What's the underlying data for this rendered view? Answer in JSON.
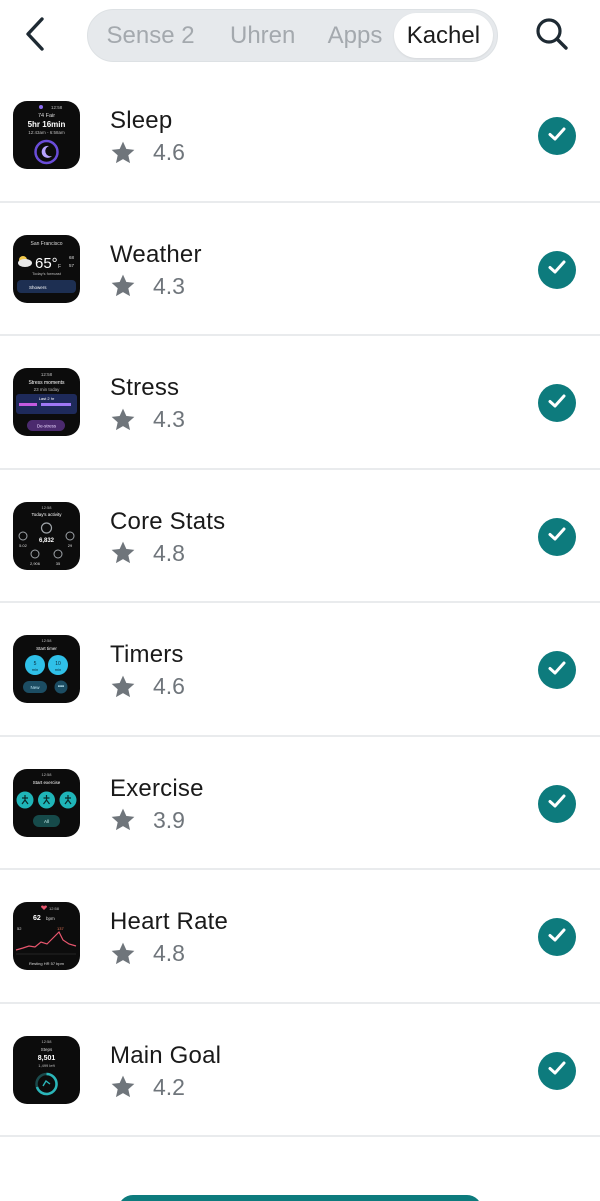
{
  "header": {
    "tabs": [
      {
        "label": "Sense 2",
        "active": false
      },
      {
        "label": "Uhren",
        "active": false
      },
      {
        "label": "Apps",
        "active": false
      },
      {
        "label": "Kachel",
        "active": true
      }
    ],
    "back_icon": "chevron-left-icon",
    "search_icon": "search-icon"
  },
  "tiles": [
    {
      "name": "Sleep",
      "rating": "4.6",
      "installed": true,
      "icon": "check-icon",
      "preview": {
        "date": "12:58",
        "line1": "74 Fair",
        "line2": "5hr 16min",
        "line3": "12:43am - 6:58am"
      }
    },
    {
      "name": "Weather",
      "rating": "4.3",
      "installed": true,
      "icon": "check-icon",
      "preview": {
        "city": "San Francisco",
        "temp": "65°",
        "unit": "F",
        "hi": "68",
        "lo": "57",
        "sub": "Today's forecast",
        "cond": "Showers"
      }
    },
    {
      "name": "Stress",
      "rating": "4.3",
      "installed": true,
      "icon": "check-icon",
      "preview": {
        "time": "12:58",
        "line1": "Stress moments",
        "line2": "23 min today",
        "line3": "Last 2 hr",
        "btn": "De-stress"
      }
    },
    {
      "name": "Core Stats",
      "rating": "4.8",
      "installed": true,
      "icon": "check-icon",
      "preview": {
        "time": "12:58",
        "line1": "Today's activity",
        "steps": "6,832",
        "a": "5.02",
        "b": "29",
        "c": "2,906",
        "d": "35"
      }
    },
    {
      "name": "Timers",
      "rating": "4.6",
      "installed": true,
      "icon": "check-icon",
      "preview": {
        "time": "12:58",
        "line1": "Start timer",
        "t1": "5",
        "t1u": "min",
        "t2": "10",
        "t2u": "min",
        "btn": "New"
      }
    },
    {
      "name": "Exercise",
      "rating": "3.9",
      "installed": true,
      "icon": "check-icon",
      "preview": {
        "time": "12:58",
        "line1": "Start exercise",
        "btn": "All"
      }
    },
    {
      "name": "Heart Rate",
      "rating": "4.8",
      "installed": true,
      "icon": "check-icon",
      "preview": {
        "time": "12:58",
        "bpm": "62",
        "unit": "bpm",
        "hi": "137",
        "lo": "52",
        "rest": "Resting HR 57 bpm"
      }
    },
    {
      "name": "Main Goal",
      "rating": "4.2",
      "installed": true,
      "icon": "check-icon",
      "preview": {
        "time": "12:58",
        "line1": "Steps",
        "steps": "8,501",
        "left": "1,499 left"
      }
    }
  ],
  "colors": {
    "accent": "#0d7b7d",
    "star": "#6f757b",
    "segment_bg": "#e6e9ec",
    "divider": "#e9ebed"
  }
}
